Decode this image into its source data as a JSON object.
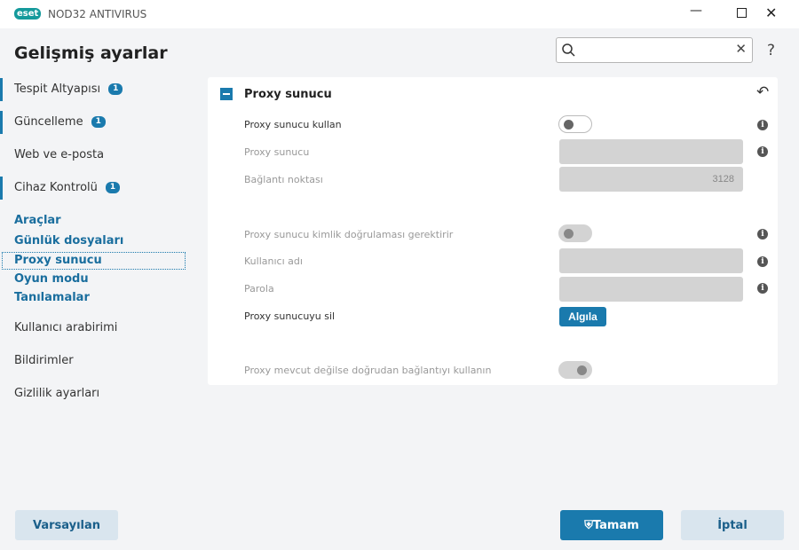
{
  "window": {
    "logo": "eset",
    "product": "NOD32 ANTIVIRUS",
    "minimize_icon": "minimize-icon",
    "maximize_icon": "maximize-icon",
    "close_icon": "close-icon"
  },
  "header": {
    "title": "Gelişmiş ayarlar",
    "search_placeholder": "",
    "help": "?"
  },
  "sidebar": {
    "items": [
      {
        "label": "Tespit Altyapısı",
        "badge": "1"
      },
      {
        "label": "Güncelleme",
        "badge": "1"
      },
      {
        "label": "Web ve e-posta"
      },
      {
        "label": "Cihaz Kontrolü",
        "badge": "1"
      },
      {
        "label": "Araçlar"
      },
      {
        "label": "Günlük dosyaları"
      },
      {
        "label": "Proxy sunucu"
      },
      {
        "label": "Oyun modu"
      },
      {
        "label": "Tanılamalar"
      },
      {
        "label": "Kullanıcı arabirimi"
      },
      {
        "label": "Bildirimler"
      },
      {
        "label": "Gizlilik ayarları"
      }
    ]
  },
  "section": {
    "title": "Proxy sunucu",
    "rows": {
      "use_proxy": {
        "label": "Proxy sunucu kullan",
        "value": false
      },
      "proxy_server": {
        "label": "Proxy sunucu",
        "value": ""
      },
      "port": {
        "label": "Bağlantı noktası",
        "value": "3128"
      },
      "auth": {
        "label": "Proxy sunucu kimlik doğrulaması gerektirir",
        "value": false
      },
      "username": {
        "label": "Kullanıcı adı",
        "value": ""
      },
      "password": {
        "label": "Parola",
        "value": ""
      },
      "clear": {
        "label": "Proxy sunucuyu sil",
        "button": "Algıla"
      },
      "direct": {
        "label": "Proxy mevcut değilse doğrudan bağlantıyı kullanın",
        "value": true
      }
    }
  },
  "footer": {
    "default": "Varsayılan",
    "ok": "Tamam",
    "cancel": "İptal"
  },
  "colors": {
    "accent": "#1a7aad",
    "logo": "#159a9c"
  }
}
